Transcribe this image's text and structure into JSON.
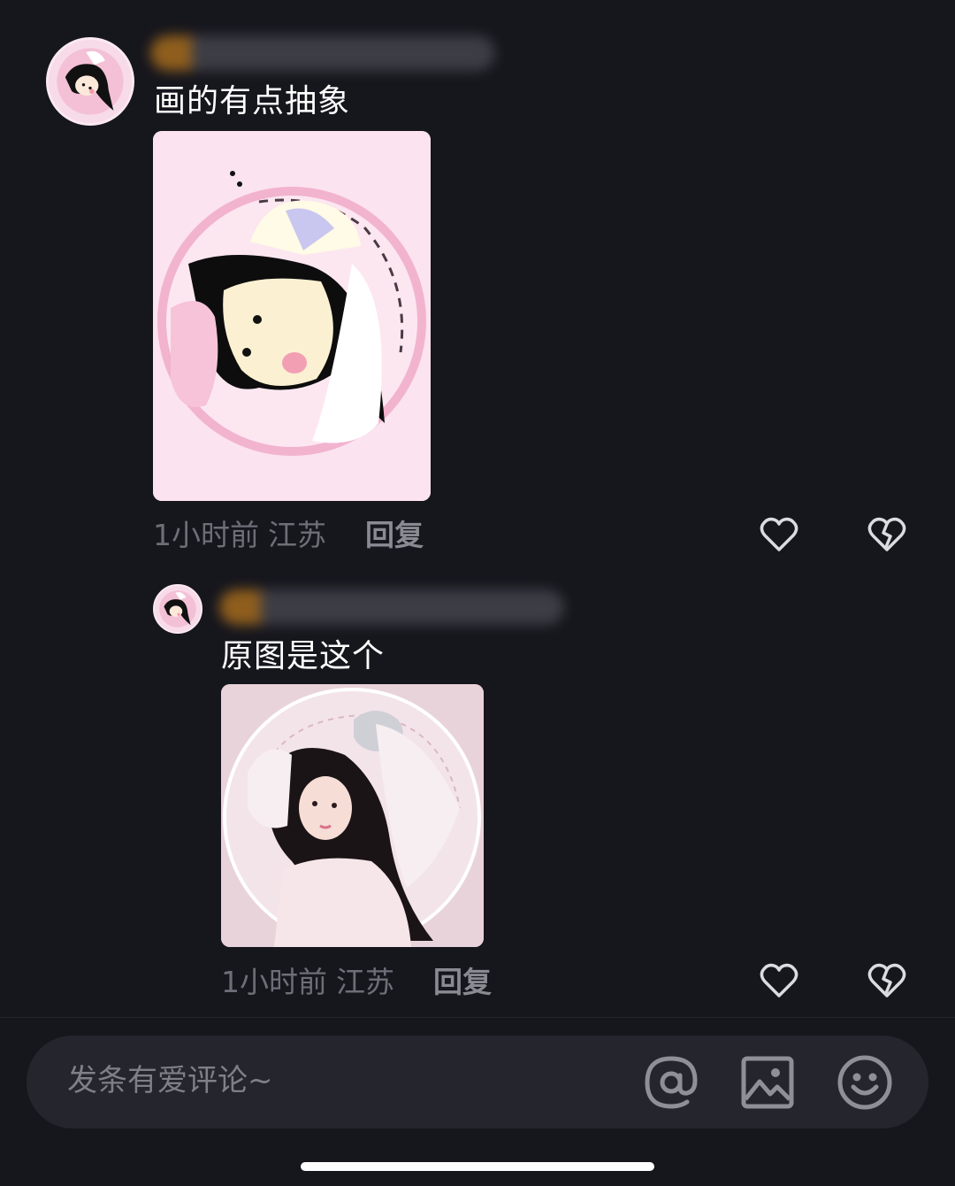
{
  "comments": [
    {
      "text": "画的有点抽象",
      "time": "1小时前",
      "location": "江苏",
      "reply_label": "回复"
    },
    {
      "text": "原图是这个",
      "time": "1小时前",
      "location": "江苏",
      "reply_label": "回复"
    }
  ],
  "composer": {
    "placeholder": "发条有爱评论~"
  },
  "icons": {
    "like": "heart-outline-icon",
    "dislike": "broken-heart-icon",
    "mention": "at-icon",
    "image": "image-icon",
    "emoji": "smile-icon"
  },
  "colors": {
    "background": "#16161d",
    "meta_text": "#6e6e78",
    "reply_text": "#8a8a93",
    "input_bg": "#25252d"
  }
}
